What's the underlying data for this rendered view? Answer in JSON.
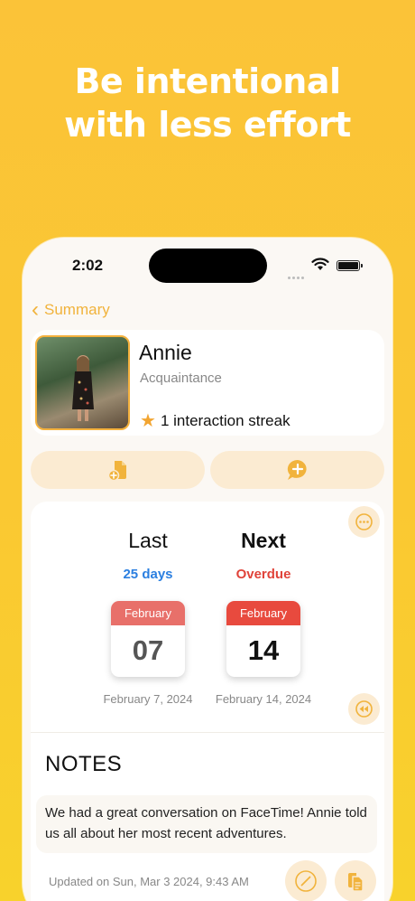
{
  "headline": {
    "line1": "Be intentional",
    "line2": "with less effort"
  },
  "status_bar": {
    "time": "2:02"
  },
  "nav": {
    "back_label": "Summary"
  },
  "profile": {
    "name": "Annie",
    "relation": "Acquaintance",
    "streak": "1 interaction streak"
  },
  "actions": {
    "left_icon": "add-document-icon",
    "right_icon": "add-message-icon"
  },
  "timeline": {
    "last": {
      "title": "Last",
      "status": "25 days",
      "month": "February",
      "day": "07",
      "date": "February 7, 2024"
    },
    "next": {
      "title": "Next",
      "status": "Overdue",
      "month": "February",
      "day": "14",
      "date": "February 14, 2024"
    }
  },
  "notes": {
    "title": "NOTES",
    "text": "We had a great conversation on FaceTime! Annie told us all about her most recent adventures.",
    "updated": "Updated on Sun, Mar 3 2024, 9:43 AM"
  },
  "colors": {
    "background": "#FBC338",
    "accent": "#F1B33C",
    "last_status": "#2B7FE0",
    "next_status": "#E0433A"
  }
}
